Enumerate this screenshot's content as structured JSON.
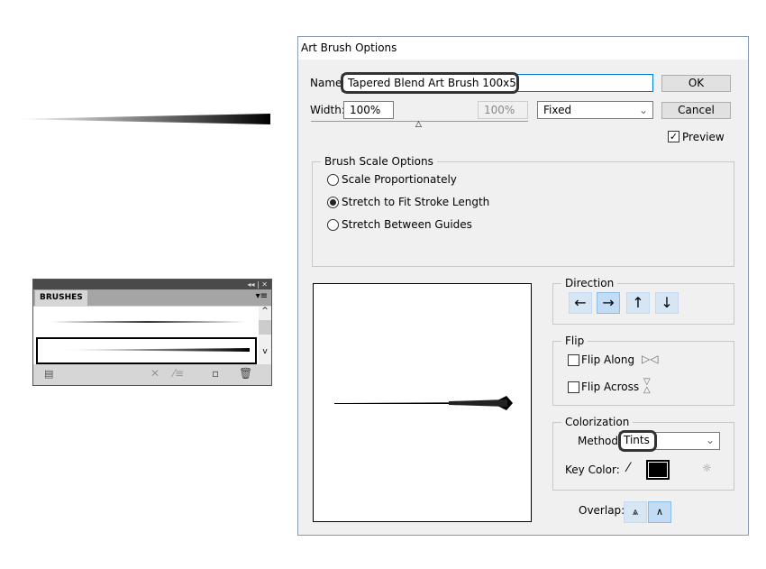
{
  "dialog": {
    "title": "Art Brush Options",
    "name_label": "Name:",
    "name_value": "Tapered Blend Art Brush 100x5",
    "ok": "OK",
    "cancel": "Cancel",
    "width_label": "Width:",
    "width_value": "100%",
    "width_max": "100%",
    "width_mode": "Fixed",
    "preview_label": "Preview",
    "preview_checked": true,
    "scale": {
      "title": "Brush Scale Options",
      "options": [
        "Scale Proportionately",
        "Stretch to Fit Stroke Length",
        "Stretch Between Guides"
      ],
      "selected": "Stretch to Fit Stroke Length"
    },
    "direction": {
      "title": "Direction",
      "buttons": [
        "←",
        "→",
        "↑",
        "↓"
      ],
      "selected": "→"
    },
    "flip": {
      "title": "Flip",
      "along": "Flip Along",
      "across": "Flip Across"
    },
    "colorization": {
      "title": "Colorization",
      "method_label": "Method:",
      "method_value": "Tints",
      "key_color_label": "Key Color:",
      "key_color": "#000000"
    },
    "overlap_label": "Overlap:"
  },
  "panel": {
    "title": "BRUSHES"
  }
}
